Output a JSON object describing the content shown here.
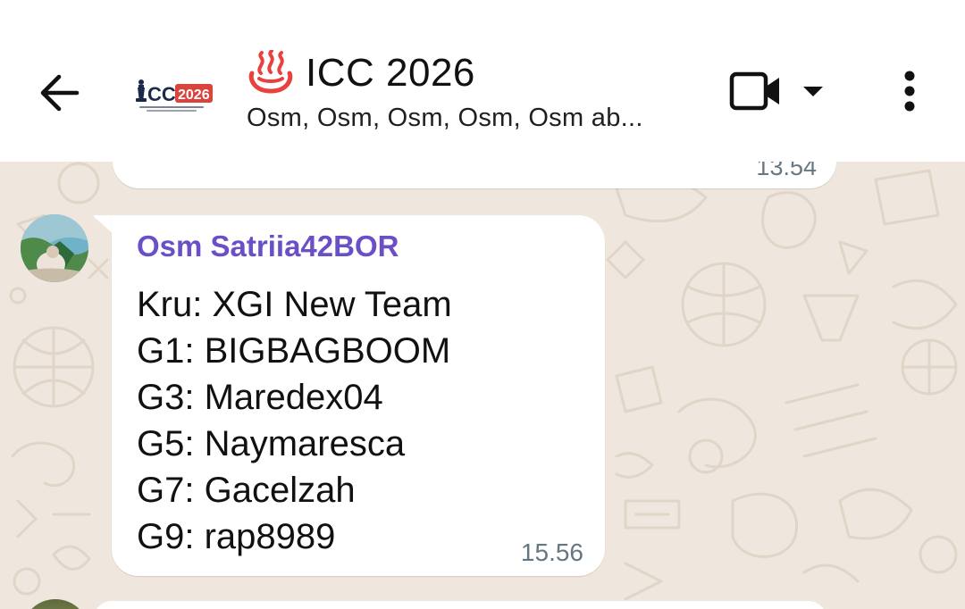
{
  "header": {
    "group_logo_text": "ICC 2026",
    "title_icon": "hot-springs-icon",
    "title": "ICC 2026",
    "subtitle": "Osm, Osm, Osm, Osm, Osm ab...",
    "icons": {
      "back": "back-arrow-icon",
      "video": "video-call-icon",
      "dropdown": "caret-down-icon",
      "menu": "more-vert-icon"
    }
  },
  "chat": {
    "previous_message": {
      "time": "13.54"
    },
    "message": {
      "sender": "Osm Satriia42BOR",
      "lines": [
        "Kru: XGI New Team",
        "G1: BIGBAGBOOM",
        "G3: Maredex04",
        "G5: Naymaresca",
        "G7: Gacelzah",
        "G9: rap8989"
      ],
      "time": "15.56"
    }
  },
  "colors": {
    "sender_name": "#6a4fc7",
    "wallpaper": "#efe7dd",
    "timestamp": "#667781",
    "title_icon": "#e8413e",
    "logo_badge": "#d9443e"
  }
}
